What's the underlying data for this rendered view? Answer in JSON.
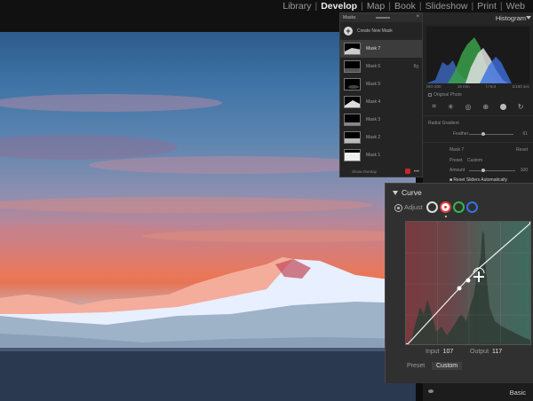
{
  "modules": {
    "items": [
      "Library",
      "Develop",
      "Map",
      "Book",
      "Slideshow",
      "Print",
      "Web"
    ],
    "active_index": 1
  },
  "histogram": {
    "title": "Histogram",
    "info": [
      "ISO 200",
      "16 mm",
      "f / 8.0",
      "1/160 sec"
    ],
    "original_photo_label": "Original Photo"
  },
  "right_panel": {
    "effect": "Radial Gradient",
    "feather_label": "Feather",
    "feather_value": "61",
    "mask_label": "Mask 7",
    "reset_label": "Reset",
    "preset_label": "Preset",
    "preset_value": "Custom",
    "amount_label": "Amount",
    "amount_value": "100",
    "auto_reset_label": "Reset Sliders Automatically",
    "basic_label": "Basic"
  },
  "masks_panel": {
    "title": "Masks",
    "create_label": "Create New Mask",
    "items": [
      {
        "name": "Mask 7",
        "selected": true,
        "extra": ""
      },
      {
        "name": "Mask 6",
        "selected": false,
        "extra": "8g"
      },
      {
        "name": "Mask 5",
        "selected": false,
        "extra": ""
      },
      {
        "name": "Mask 4",
        "selected": false,
        "extra": ""
      },
      {
        "name": "Mask 3",
        "selected": false,
        "extra": ""
      },
      {
        "name": "Mask 2",
        "selected": false,
        "extra": ""
      },
      {
        "name": "Mask 1",
        "selected": false,
        "extra": ""
      }
    ],
    "show_overlay_label": "Show Overlay",
    "overlay_color": "#c8232a"
  },
  "curve_panel": {
    "title": "Curve",
    "adjust_label": "Adjust",
    "channels": [
      "rgb",
      "red",
      "green",
      "blue"
    ],
    "active_channel": "red",
    "input_label": "Input",
    "input_value": "107",
    "output_label": "Output",
    "output_value": "117",
    "preset_label": "Preset",
    "preset_value": "Custom"
  },
  "colors": {
    "accent_red": "#e23b3b",
    "accent_green": "#33b84a",
    "accent_blue": "#3b6fe0"
  }
}
